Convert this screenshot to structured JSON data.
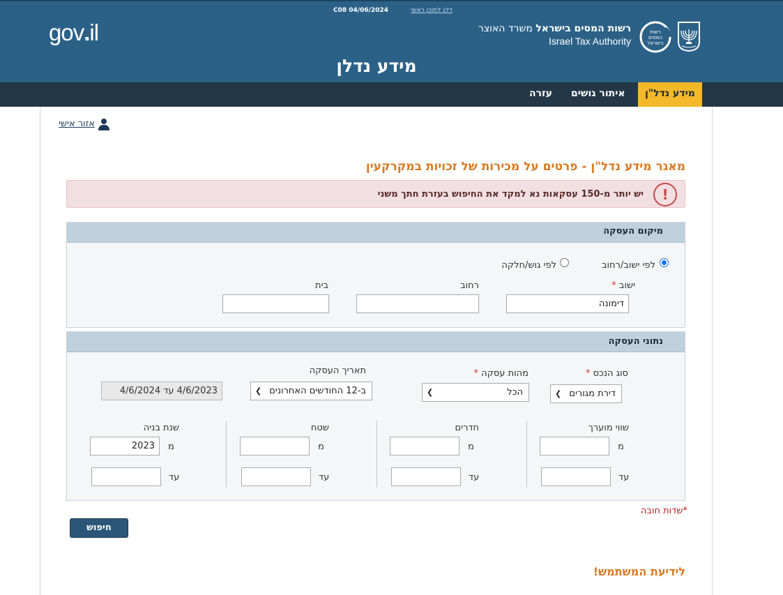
{
  "header": {
    "top_link": "דלג לתוכן ראשי",
    "top_code": "C08 04/06/2024",
    "gov_logo": "gov.il",
    "gov_logo_a": "gov",
    "gov_logo_b": "il",
    "authority_he_bold": "רשות המסים בישראל",
    "authority_he_rest": " משרד האוצר",
    "authority_en": "Israel Tax Authority",
    "page_title": "מידע נדלן",
    "emblem_icon": "menorah-emblem-icon",
    "logo_icon": "tax-authority-logo-icon"
  },
  "nav": {
    "items": [
      "מידע נדל\"ן",
      "איתור גושים",
      "עזרה"
    ],
    "active_index": 0
  },
  "personal_area": "אזור אישי",
  "main_heading": "מאגר מידע נדל\"ן - פרטים על מכירות של זכויות במקרקעין",
  "alert": {
    "icon": "exclamation-icon",
    "text": "יש יותר מ-150 עסקאות נא למקד את החיפוש בעזרת חתך משני"
  },
  "location_panel": {
    "title": "מיקום העסקה",
    "radio_by_city": "לפי ישוב/רחוב",
    "radio_by_block": "לפי גוש/חלקה",
    "selected_radio": "by_city",
    "city_label": "ישוב",
    "city_value": "דימונה",
    "street_label": "רחוב",
    "street_value": "",
    "house_label": "בית",
    "house_value": ""
  },
  "deal_panel": {
    "title": "נתוני העסקה",
    "property_type_label": "סוג הנכס",
    "property_type_value": "דירת מגורים",
    "deal_nature_label": "מהות עסקה",
    "deal_nature_value": "הכל",
    "deal_date_label": "תאריך העסקה",
    "deal_date_value": "ב-12 החודשים האחרונים",
    "date_range_value": "4/6/2023 עד 4/6/2024",
    "ranges": [
      {
        "label": "שווי מוערך",
        "from_label": "מ",
        "to_label": "עד",
        "from_value": "",
        "to_value": ""
      },
      {
        "label": "חדרים",
        "from_label": "מ",
        "to_label": "עד",
        "from_value": "",
        "to_value": ""
      },
      {
        "label": "שטח",
        "from_label": "מ",
        "to_label": "עד",
        "from_value": "",
        "to_value": ""
      },
      {
        "label": "שנת בניה",
        "from_label": "מ",
        "to_label": "עד",
        "from_value": "2023",
        "to_value": ""
      }
    ]
  },
  "required_note": "*שדות חובה",
  "search_button": "חיפוש",
  "notice_heading": "לידיעת המשתמש!",
  "colors": {
    "header_bg": "#2c6187",
    "nav_bg": "#233746",
    "nav_active": "#f4b82a",
    "heading_orange": "#d87a22",
    "alert_bg": "#f2dfe1",
    "button_bg": "#2b5677"
  }
}
